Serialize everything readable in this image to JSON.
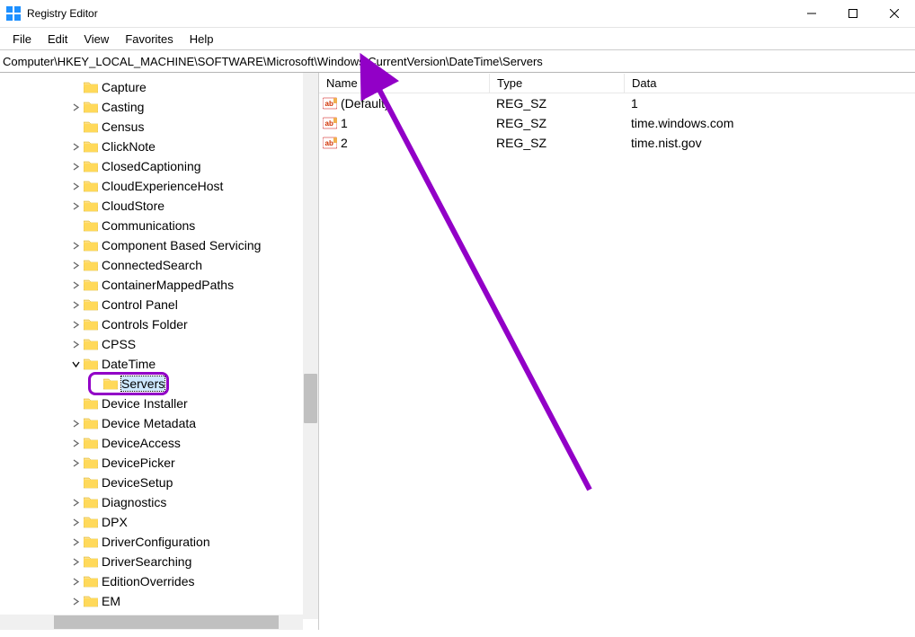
{
  "window": {
    "title": "Registry Editor"
  },
  "menu": {
    "file": "File",
    "edit": "Edit",
    "view": "View",
    "favorites": "Favorites",
    "help": "Help"
  },
  "address": {
    "path": "Computer\\HKEY_LOCAL_MACHINE\\SOFTWARE\\Microsoft\\Windows\\CurrentVersion\\DateTime\\Servers"
  },
  "tree": [
    {
      "indent": 78,
      "expander": "",
      "label": "Capture"
    },
    {
      "indent": 78,
      "expander": ">",
      "label": "Casting"
    },
    {
      "indent": 78,
      "expander": "",
      "label": "Census"
    },
    {
      "indent": 78,
      "expander": ">",
      "label": "ClickNote"
    },
    {
      "indent": 78,
      "expander": ">",
      "label": "ClosedCaptioning"
    },
    {
      "indent": 78,
      "expander": ">",
      "label": "CloudExperienceHost"
    },
    {
      "indent": 78,
      "expander": ">",
      "label": "CloudStore"
    },
    {
      "indent": 78,
      "expander": "",
      "label": "Communications"
    },
    {
      "indent": 78,
      "expander": ">",
      "label": "Component Based Servicing"
    },
    {
      "indent": 78,
      "expander": ">",
      "label": "ConnectedSearch"
    },
    {
      "indent": 78,
      "expander": ">",
      "label": "ContainerMappedPaths"
    },
    {
      "indent": 78,
      "expander": ">",
      "label": "Control Panel"
    },
    {
      "indent": 78,
      "expander": ">",
      "label": "Controls Folder"
    },
    {
      "indent": 78,
      "expander": ">",
      "label": "CPSS"
    },
    {
      "indent": 78,
      "expander": "v",
      "label": "DateTime"
    },
    {
      "indent": 100,
      "expander": "",
      "label": "Servers",
      "selected": true
    },
    {
      "indent": 78,
      "expander": "",
      "label": "Device Installer"
    },
    {
      "indent": 78,
      "expander": ">",
      "label": "Device Metadata"
    },
    {
      "indent": 78,
      "expander": ">",
      "label": "DeviceAccess"
    },
    {
      "indent": 78,
      "expander": ">",
      "label": "DevicePicker"
    },
    {
      "indent": 78,
      "expander": "",
      "label": "DeviceSetup"
    },
    {
      "indent": 78,
      "expander": ">",
      "label": "Diagnostics"
    },
    {
      "indent": 78,
      "expander": ">",
      "label": "DPX"
    },
    {
      "indent": 78,
      "expander": ">",
      "label": "DriverConfiguration"
    },
    {
      "indent": 78,
      "expander": ">",
      "label": "DriverSearching"
    },
    {
      "indent": 78,
      "expander": ">",
      "label": "EditionOverrides"
    },
    {
      "indent": 78,
      "expander": ">",
      "label": "EM"
    }
  ],
  "list": {
    "columns": {
      "name": "Name",
      "type": "Type",
      "data": "Data"
    },
    "rows": [
      {
        "name": "(Default)",
        "type": "REG_SZ",
        "data": "1"
      },
      {
        "name": "1",
        "type": "REG_SZ",
        "data": "time.windows.com"
      },
      {
        "name": "2",
        "type": "REG_SZ",
        "data": "time.nist.gov"
      }
    ]
  }
}
